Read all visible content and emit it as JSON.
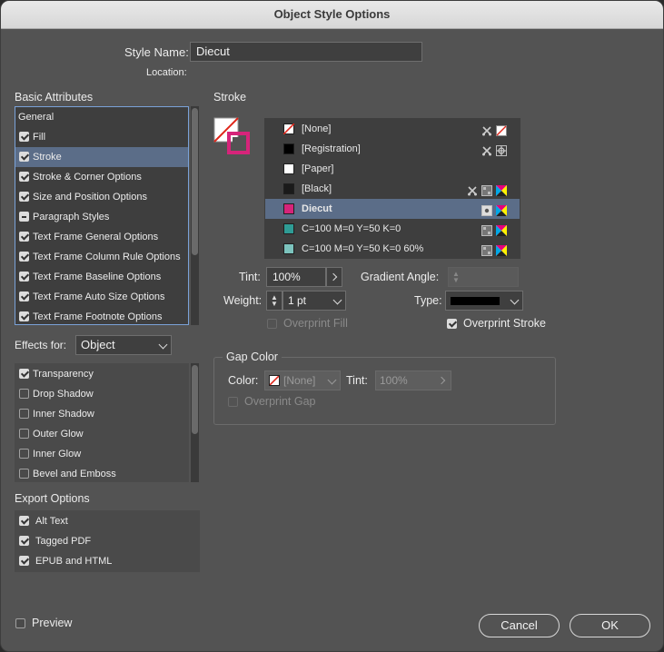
{
  "window": {
    "title": "Object Style Options"
  },
  "style_name": {
    "label": "Style Name:",
    "value": "Diecut"
  },
  "location": {
    "label": "Location:"
  },
  "basic_attributes": {
    "title": "Basic Attributes",
    "items": [
      {
        "label": "General",
        "check": "none"
      },
      {
        "label": "Fill",
        "check": "on"
      },
      {
        "label": "Stroke",
        "check": "on",
        "selected": true
      },
      {
        "label": "Stroke & Corner Options",
        "check": "on"
      },
      {
        "label": "Size and Position Options",
        "check": "on"
      },
      {
        "label": "Paragraph Styles",
        "check": "mixed"
      },
      {
        "label": "Text Frame General Options",
        "check": "on"
      },
      {
        "label": "Text Frame Column Rule Options",
        "check": "on"
      },
      {
        "label": "Text Frame Baseline Options",
        "check": "on"
      },
      {
        "label": "Text Frame Auto Size Options",
        "check": "on"
      },
      {
        "label": "Text Frame Footnote Options",
        "check": "on"
      }
    ]
  },
  "effects_for": {
    "label": "Effects for:",
    "value": "Object"
  },
  "effects": {
    "items": [
      {
        "label": "Transparency",
        "check": "on"
      },
      {
        "label": "Drop Shadow",
        "check": "off"
      },
      {
        "label": "Inner Shadow",
        "check": "off"
      },
      {
        "label": "Outer Glow",
        "check": "off"
      },
      {
        "label": "Inner Glow",
        "check": "off"
      },
      {
        "label": "Bevel and Emboss",
        "check": "off"
      }
    ]
  },
  "export_options": {
    "title": "Export Options",
    "items": [
      {
        "label": "Alt Text",
        "check": "on"
      },
      {
        "label": "Tagged PDF",
        "check": "on"
      },
      {
        "label": "EPUB and HTML",
        "check": "on"
      }
    ]
  },
  "preview": {
    "label": "Preview",
    "checked": false
  },
  "stroke": {
    "title": "Stroke",
    "swatches": [
      {
        "name": "[None]",
        "color": "none",
        "icons": [
          "scissors-icon",
          "none-icon"
        ]
      },
      {
        "name": "[Registration]",
        "color": "#000000",
        "icons": [
          "scissors-icon",
          "registration-icon"
        ]
      },
      {
        "name": "[Paper]",
        "color": "#ffffff",
        "icons": []
      },
      {
        "name": "[Black]",
        "color": "#1a1a1a",
        "icons": [
          "scissors-icon",
          "process-icon",
          "cmyk-icon"
        ]
      },
      {
        "name": "Diecut",
        "color": "#d6247a",
        "icons": [
          "spot-icon",
          "cmyk-icon"
        ],
        "selected": true
      },
      {
        "name": "C=100 M=0 Y=50 K=0",
        "color": "#2f9c95",
        "icons": [
          "process-icon",
          "cmyk-icon"
        ]
      },
      {
        "name": "C=100 M=0 Y=50 K=0 60%",
        "color": "#7cc3bd",
        "icons": [
          "process-icon",
          "cmyk-icon"
        ]
      }
    ],
    "tint_label": "Tint:",
    "tint_value": "100%",
    "gradient_angle_label": "Gradient Angle:",
    "weight_label": "Weight:",
    "weight_value": "1 pt",
    "type_label": "Type:",
    "overprint_fill_label": "Overprint Fill",
    "overprint_stroke_label": "Overprint Stroke"
  },
  "gap_color": {
    "title": "Gap Color",
    "color_label": "Color:",
    "color_value": "[None]",
    "tint_label": "Tint:",
    "tint_value": "100%",
    "overprint_gap_label": "Overprint Gap"
  },
  "buttons": {
    "cancel": "Cancel",
    "ok": "OK"
  },
  "colors": {
    "dialog_bg": "#535353",
    "selection": "#5b6d88",
    "diecut": "#d6247a"
  }
}
